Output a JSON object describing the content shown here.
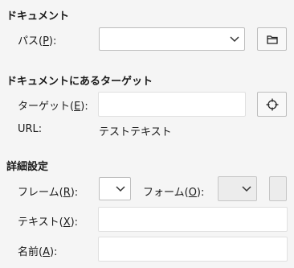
{
  "document": {
    "heading": "ドキュメント",
    "path_label": "パス(",
    "path_key": "P",
    "path_suffix": "):",
    "path_value": ""
  },
  "target_section": {
    "heading": "ドキュメントにあるターゲット",
    "target_label": "ターゲット(",
    "target_key": "E",
    "target_suffix": "):",
    "target_value": "",
    "url_label": "URL:",
    "url_value": "テストテキスト"
  },
  "advanced": {
    "heading": "詳細設定",
    "frame_label": "フレーム(",
    "frame_key": "R",
    "frame_suffix": "):",
    "frame_value": "",
    "form_label": "フォーム(",
    "form_key": "O",
    "form_suffix": "):",
    "form_value": "",
    "text_label": "テキスト(",
    "text_key": "X",
    "text_suffix": "):",
    "text_value": "",
    "name_label": "名前(",
    "name_key": "A",
    "name_suffix": "):",
    "name_value": ""
  },
  "icons": {
    "open_file": "folder-icon",
    "target": "crosshair-icon",
    "dropdown": "chevron-down-icon"
  }
}
